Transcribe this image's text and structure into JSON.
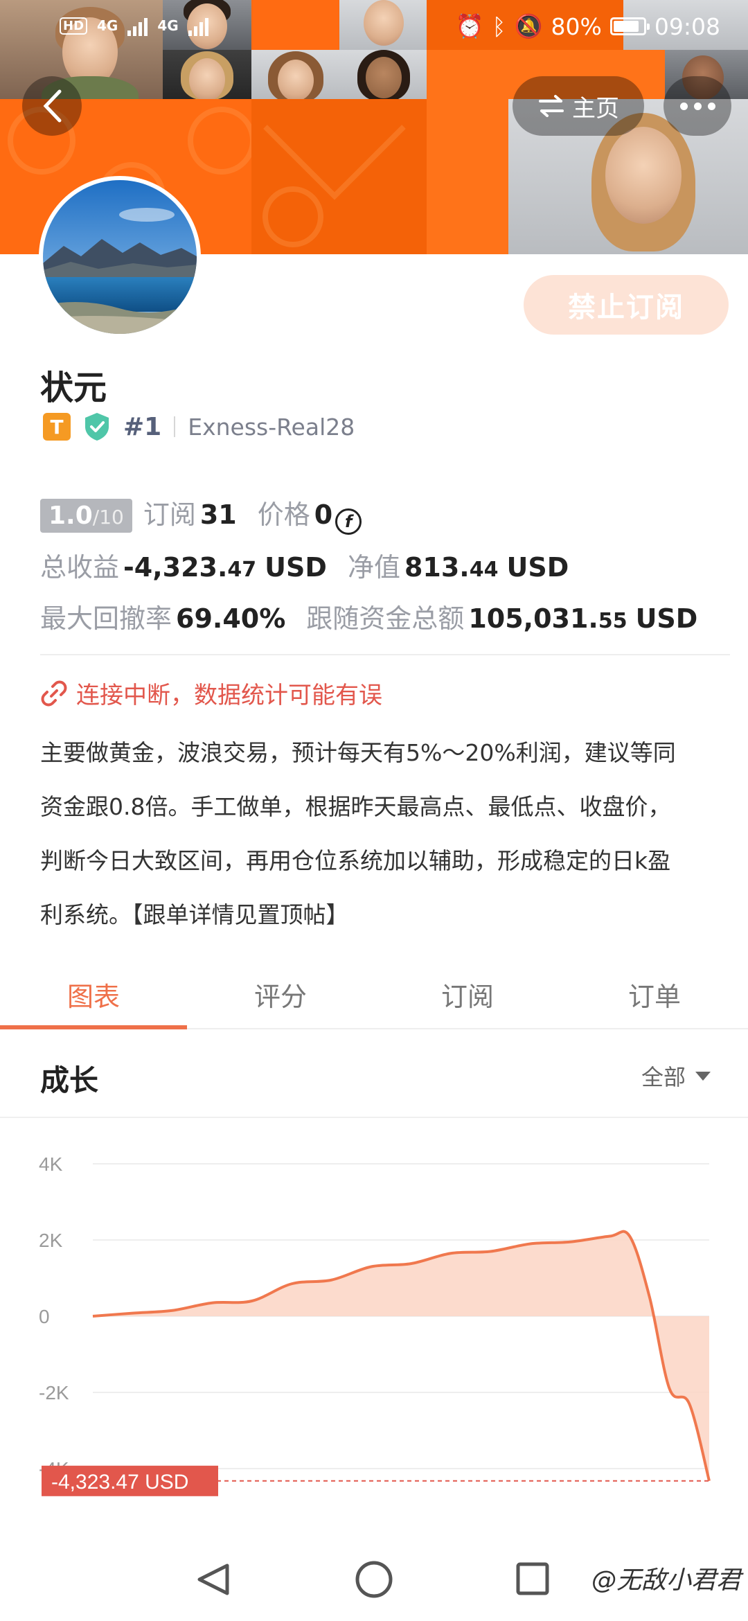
{
  "status_bar": {
    "network_left": "HD",
    "network_sub": "2",
    "net1": "4G",
    "net2": "4G",
    "battery": "80%",
    "time": "09:08"
  },
  "nav": {
    "home_label": "主页"
  },
  "profile": {
    "name": "状元",
    "level_badge": "T",
    "rank": "#1",
    "account": "Exness-Real28",
    "subscribe_button": "禁止订阅"
  },
  "stats": {
    "score": "1.0",
    "score_total": "/10",
    "subscribe_label": "订阅",
    "subscribe_count": "31",
    "price_label": "价格",
    "price_value": "0",
    "price_icon": "f-coin-icon",
    "total_profit_label": "总收益",
    "total_profit_main": "-4,323.",
    "total_profit_dec": "47",
    "total_profit_unit": "USD",
    "equity_label": "净值",
    "equity_main": "813.",
    "equity_dec": "44",
    "equity_unit": "USD",
    "drawdown_label": "最大回撤率",
    "drawdown_value": "69.40%",
    "follow_label": "跟随资金总额",
    "follow_main": "105,031.",
    "follow_dec": "55",
    "follow_unit": "USD"
  },
  "warning": "连接中断，数据统计可能有误",
  "description_lines": [
    "主要做黄金，波浪交易，预计每天有5%～20%利润，建议等同",
    "资金跟0.8倍。手工做单，根据昨天最高点、最低点、收盘价，",
    "判断今日大致区间，再用仓位系统加以辅助，形成稳定的日k盈",
    "利系统。【跟单详情见置顶帖】"
  ],
  "tabs": [
    "图表",
    "评分",
    "订阅",
    "订单"
  ],
  "active_tab": 0,
  "section": {
    "title": "成长",
    "filter": "全部"
  },
  "colors": {
    "accent": "#ef7049",
    "orange_banner": "#ff6b12",
    "warning_red": "#e2574c",
    "chart_line": "#f0784e",
    "chart_fill": "#fcd5c4"
  },
  "chart_data": {
    "type": "area",
    "ylim": [
      -4000,
      4000
    ],
    "y_ticks": [
      "4K",
      "2K",
      "0",
      "-2K",
      "-4K"
    ],
    "y_tick_values": [
      4000,
      2000,
      0,
      -2000,
      -4000
    ],
    "x": [
      0,
      2,
      4,
      6,
      8,
      10,
      12,
      14,
      16,
      18,
      20,
      22,
      24,
      26,
      27,
      28,
      29,
      30,
      31
    ],
    "values": [
      0,
      80,
      150,
      350,
      400,
      850,
      950,
      1300,
      1380,
      1650,
      1700,
      1900,
      1950,
      2100,
      2100,
      500,
      -1900,
      -2300,
      -4323.47
    ],
    "last_value_label": "-4,323.47 USD"
  },
  "watermark": "@无敌小君君"
}
